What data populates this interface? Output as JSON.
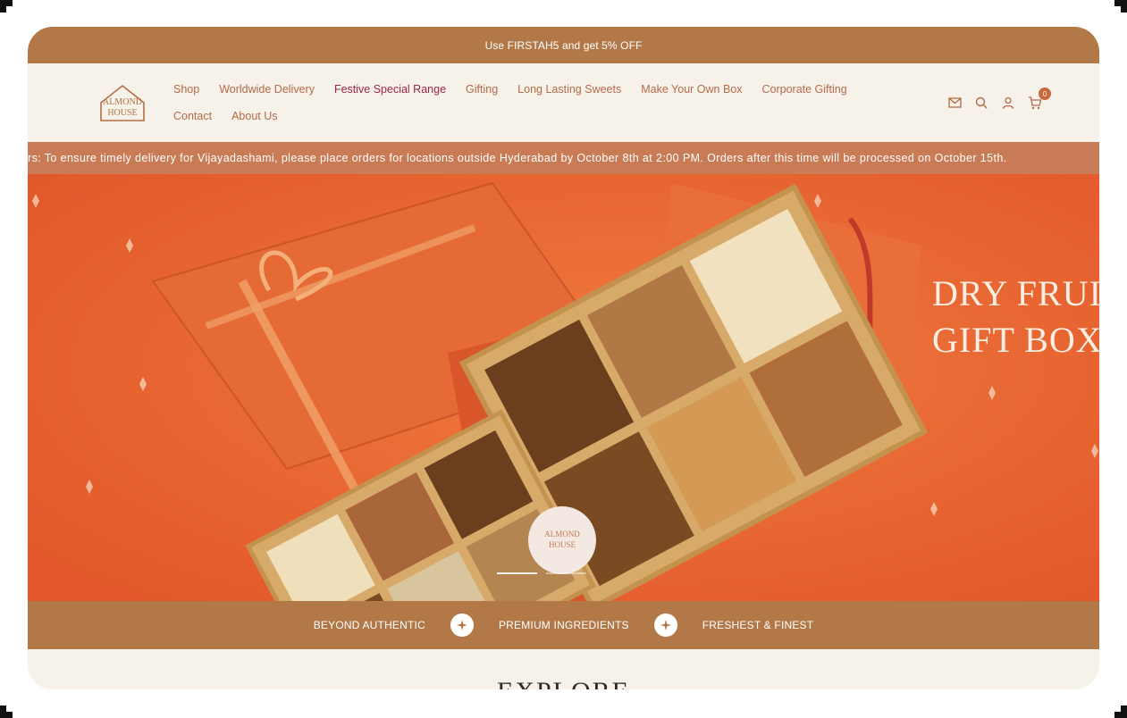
{
  "announcement": "Use FIRSTAH5 and get 5% OFF",
  "logo_text": {
    "line1": "ALMOND",
    "line2": "HOUSE"
  },
  "nav": [
    {
      "label": "Shop"
    },
    {
      "label": "Worldwide Delivery"
    },
    {
      "label": "Festive Special Range"
    },
    {
      "label": "Gifting"
    },
    {
      "label": "Long Lasting Sweets"
    },
    {
      "label": "Make Your Own Box"
    },
    {
      "label": "Corporate Gifting"
    },
    {
      "label": "Contact"
    },
    {
      "label": "About Us"
    }
  ],
  "header_icons": [
    "mail-icon",
    "search-icon",
    "account-icon",
    "cart-icon"
  ],
  "cart_count": "0",
  "ticker": "rs: To ensure timely delivery for Vijayadashami, please place orders for locations outside Hyderabad by October 8th at 2:00 PM. Orders after this time will be processed on October 15th.",
  "hero": {
    "title_line1": "DRY FRUI",
    "title_line2": "GIFT BOXE",
    "tag_text": {
      "line1": "ALMOND",
      "line2": "HOUSE"
    }
  },
  "slides": {
    "active_index": 1,
    "count": 2
  },
  "features": [
    "BEYOND AUTHENTIC",
    "PREMIUM INGREDIENTS",
    "FRESHEST & FINEST"
  ],
  "section_heading": "EXPLORE",
  "colors": {
    "brand_brown": "#b37848",
    "hero_orange": "#e86633",
    "nav_text": "#b56a48",
    "nav_active": "#9b2448",
    "cream": "#f6f2ea"
  }
}
